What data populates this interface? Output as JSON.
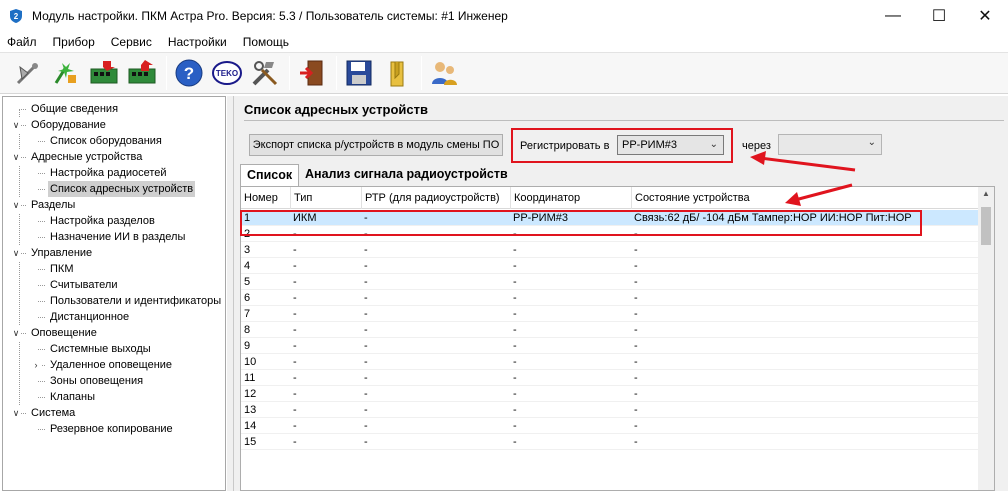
{
  "window": {
    "title": "Модуль настройки. ПКМ Астра Pro. Версия: 5.3 / Пользователь системы: #1 Инженер",
    "minimize": "—",
    "maximize": "☐",
    "close": "✕"
  },
  "menu": [
    "Файл",
    "Прибор",
    "Сервис",
    "Настройки",
    "Помощь"
  ],
  "toolbar": {
    "buttons": [
      "satellite-icon",
      "wizard-icon",
      "read-device-icon",
      "write-device-icon",
      "help-icon",
      "teko-icon",
      "tools-icon",
      "exit-icon",
      "save-icon",
      "open-icon",
      "users-icon"
    ],
    "teko_label": "TEKO",
    "help_label": "?"
  },
  "tree": [
    {
      "label": "Общие сведения",
      "level": 0,
      "toggle": ""
    },
    {
      "label": "Оборудование",
      "level": 0,
      "toggle": "v"
    },
    {
      "label": "Список оборудования",
      "level": 1,
      "toggle": ""
    },
    {
      "label": "Адресные устройства",
      "level": 0,
      "toggle": "v"
    },
    {
      "label": "Настройка радиосетей",
      "level": 1,
      "toggle": ""
    },
    {
      "label": "Список адресных устройств",
      "level": 1,
      "toggle": "",
      "selected": true
    },
    {
      "label": "Разделы",
      "level": 0,
      "toggle": "v"
    },
    {
      "label": "Настройка разделов",
      "level": 1,
      "toggle": ""
    },
    {
      "label": "Назначение ИИ в разделы",
      "level": 1,
      "toggle": ""
    },
    {
      "label": "Управление",
      "level": 0,
      "toggle": "v"
    },
    {
      "label": "ПКМ",
      "level": 1,
      "toggle": ""
    },
    {
      "label": "Считыватели",
      "level": 1,
      "toggle": ""
    },
    {
      "label": "Пользователи и идентификаторы",
      "level": 1,
      "toggle": ""
    },
    {
      "label": "Дистанционное",
      "level": 1,
      "toggle": ""
    },
    {
      "label": "Оповещение",
      "level": 0,
      "toggle": "v"
    },
    {
      "label": "Системные выходы",
      "level": 1,
      "toggle": ""
    },
    {
      "label": "Удаленное оповещение",
      "level": 1,
      "toggle": ">"
    },
    {
      "label": "Зоны оповещения",
      "level": 1,
      "toggle": ""
    },
    {
      "label": "Клапаны",
      "level": 1,
      "toggle": ""
    },
    {
      "label": "Система",
      "level": 0,
      "toggle": "v"
    },
    {
      "label": "Резервное копирование",
      "level": 1,
      "toggle": ""
    }
  ],
  "main": {
    "section_title": "Список адресных устройств",
    "export_button": "Экспорт списка р/устройств в модуль смены ПО",
    "register_label": "Регистрировать в",
    "register_value": "РР-РИМ#3",
    "via_label": "через",
    "via_value": "",
    "tabs": [
      "Список",
      "Анализ сигнала радиоустройств"
    ],
    "columns": [
      "Номер",
      "Тип",
      "РТР (для радиоустройств)",
      "Координатор",
      "Состояние устройства"
    ],
    "rows": [
      [
        "1",
        "ИКМ",
        "-",
        "РР-РИМ#3",
        "Связь:62 дБ/ -104 дБм Тампер:НОР ИИ:НОР Пит:НОР"
      ],
      [
        "2",
        "-",
        "-",
        "-",
        "-"
      ],
      [
        "3",
        "-",
        "-",
        "-",
        "-"
      ],
      [
        "4",
        "-",
        "-",
        "-",
        "-"
      ],
      [
        "5",
        "-",
        "-",
        "-",
        "-"
      ],
      [
        "6",
        "-",
        "-",
        "-",
        "-"
      ],
      [
        "7",
        "-",
        "-",
        "-",
        "-"
      ],
      [
        "8",
        "-",
        "-",
        "-",
        "-"
      ],
      [
        "9",
        "-",
        "-",
        "-",
        "-"
      ],
      [
        "10",
        "-",
        "-",
        "-",
        "-"
      ],
      [
        "11",
        "-",
        "-",
        "-",
        "-"
      ],
      [
        "12",
        "-",
        "-",
        "-",
        "-"
      ],
      [
        "13",
        "-",
        "-",
        "-",
        "-"
      ],
      [
        "14",
        "-",
        "-",
        "-",
        "-"
      ],
      [
        "15",
        "-",
        "-",
        "-",
        "-"
      ]
    ]
  },
  "colors": {
    "annotation": "#e0141e",
    "selection": "#cce8ff",
    "tree_selection": "#cfcfcf"
  }
}
